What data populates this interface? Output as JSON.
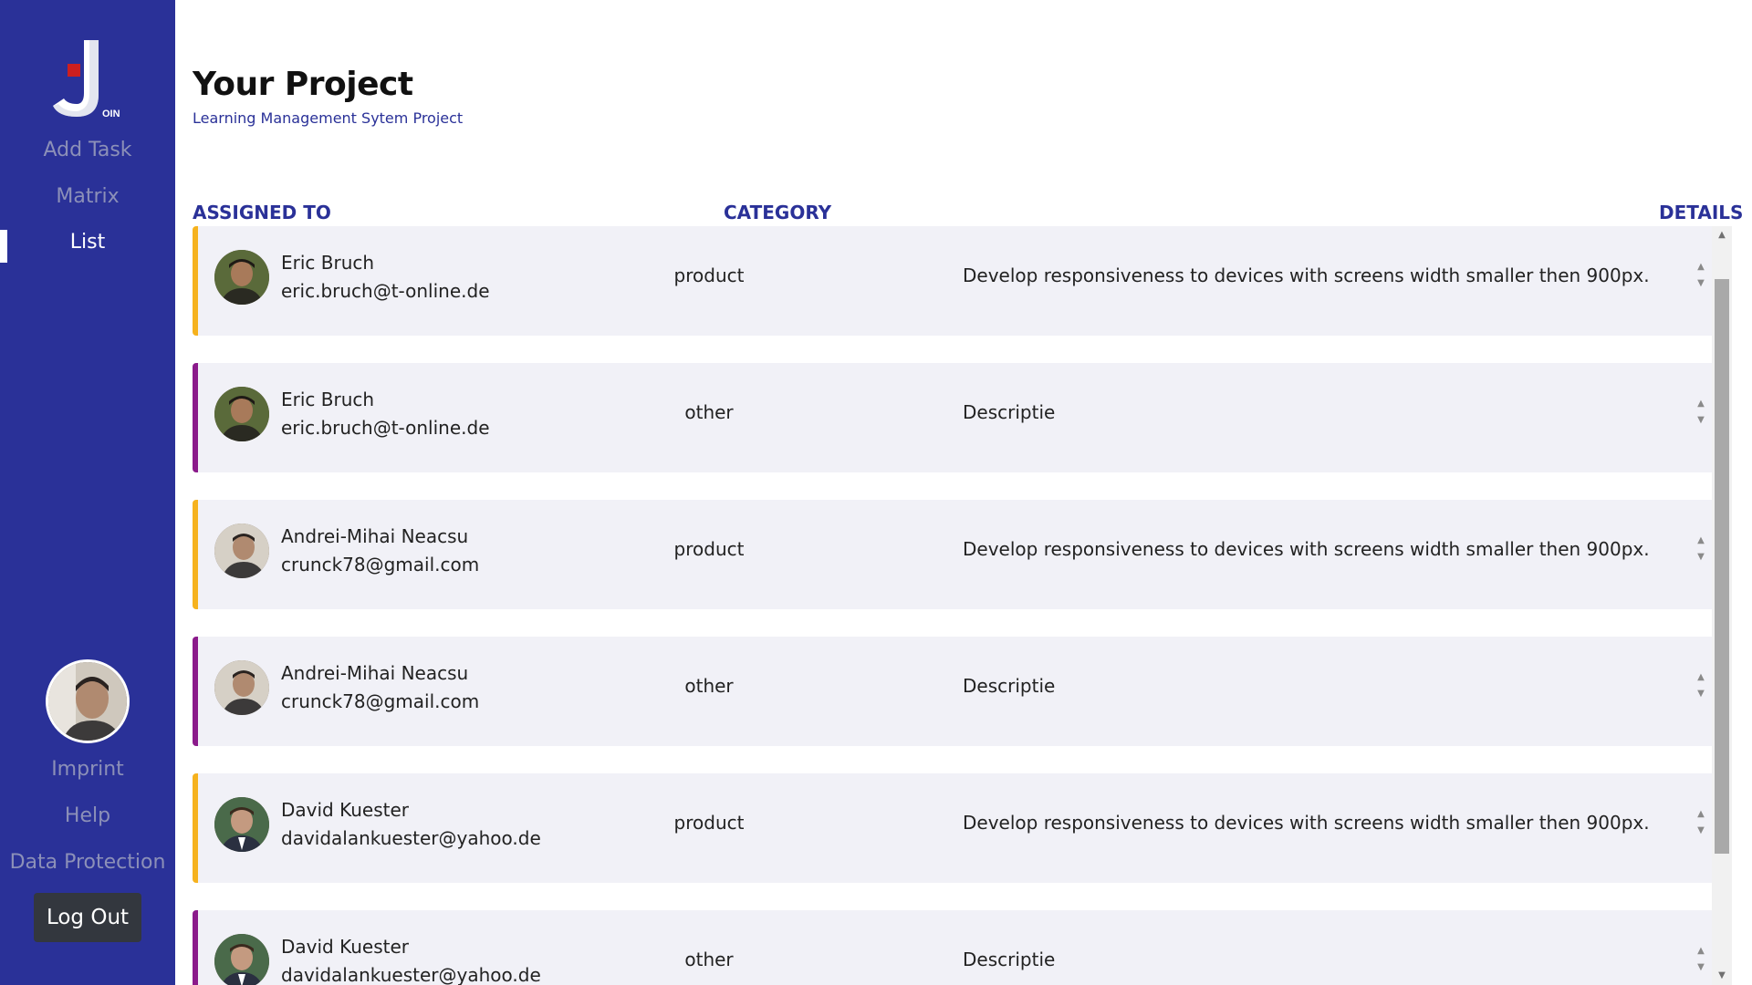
{
  "sidebar": {
    "logo_text": "OIN",
    "nav": [
      {
        "label": "Add Task"
      },
      {
        "label": "Matrix"
      },
      {
        "label": "List"
      }
    ],
    "footer": [
      {
        "label": "Imprint"
      },
      {
        "label": "Help"
      },
      {
        "label": "Data Protection"
      }
    ],
    "logout_label": "Log Out",
    "colors": {
      "background": "#2a3198",
      "muted_text": "#8c90b8",
      "active_text": "#ffffff"
    }
  },
  "header": {
    "title": "Your Project",
    "subtitle": "Learning Management Sytem Project"
  },
  "columns": {
    "assigned_to": "ASSIGNED TO",
    "category": "CATEGORY",
    "details": "DETAILS"
  },
  "category_colors": {
    "product": "#f6b21e",
    "other": "#8b1a8b"
  },
  "rows": [
    {
      "name": "Eric Bruch",
      "email": "eric.bruch@t-online.de",
      "category": "product",
      "description": "Develop responsiveness to devices with screens width smaller then 900px."
    },
    {
      "name": "Eric Bruch",
      "email": "eric.bruch@t-online.de",
      "category": "other",
      "description": "Descriptie"
    },
    {
      "name": "Andrei-Mihai Neacsu",
      "email": "crunck78@gmail.com",
      "category": "product",
      "description": "Develop responsiveness to devices with screens width smaller then 900px."
    },
    {
      "name": "Andrei-Mihai Neacsu",
      "email": "crunck78@gmail.com",
      "category": "other",
      "description": "Descriptie"
    },
    {
      "name": "David Kuester",
      "email": "davidalankuester@yahoo.de",
      "category": "product",
      "description": "Develop responsiveness to devices with screens width smaller then 900px."
    },
    {
      "name": "David Kuester",
      "email": "davidalankuester@yahoo.de",
      "category": "other",
      "description": "Descriptie"
    }
  ]
}
